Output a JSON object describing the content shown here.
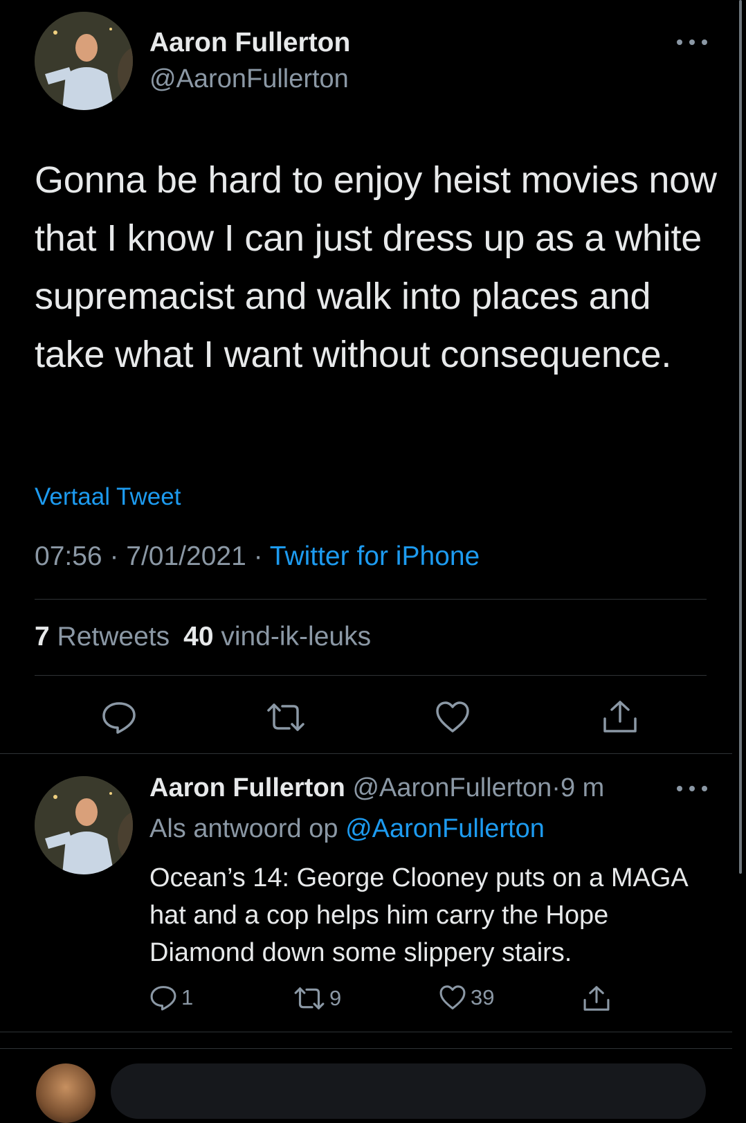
{
  "main_tweet": {
    "author_name": "Aaron Fullerton",
    "author_handle": "@AaronFullerton",
    "text": "Gonna be hard to enjoy heist movies now that I know I can just dress up as a white supremacist and walk into places and take what I want without consequence.",
    "translate_label": "Vertaal Tweet",
    "time": "07:56",
    "date": "7/01/2021",
    "separator": " · ",
    "source": "Twitter for iPhone",
    "retweet_count": "7",
    "retweet_label": "Retweets",
    "like_count": "40",
    "like_label": "vind-ik-leuks",
    "icons": [
      "more-icon",
      "reply-icon",
      "retweet-icon",
      "like-icon",
      "share-icon"
    ]
  },
  "reply_tweet": {
    "author_name": "Aaron Fullerton",
    "author_handle": "@AaronFullerton",
    "age": "9 m",
    "replying_to_label": "Als antwoord op",
    "replying_to_handle": "@AaronFullerton",
    "text": "Ocean’s 14: George Clooney puts on a MAGA hat and a cop helps him carry the Hope Diamond down some slippery stairs.",
    "reply_count": "1",
    "retweet_count": "9",
    "like_count": "39",
    "icons": [
      "more-icon",
      "reply-icon",
      "retweet-icon",
      "like-icon",
      "share-icon"
    ]
  },
  "colors": {
    "background": "#000000",
    "primary_text": "#e7e9ea",
    "secondary_text": "#8b98a5",
    "link": "#1d9bf0",
    "divider": "#2f3336"
  }
}
